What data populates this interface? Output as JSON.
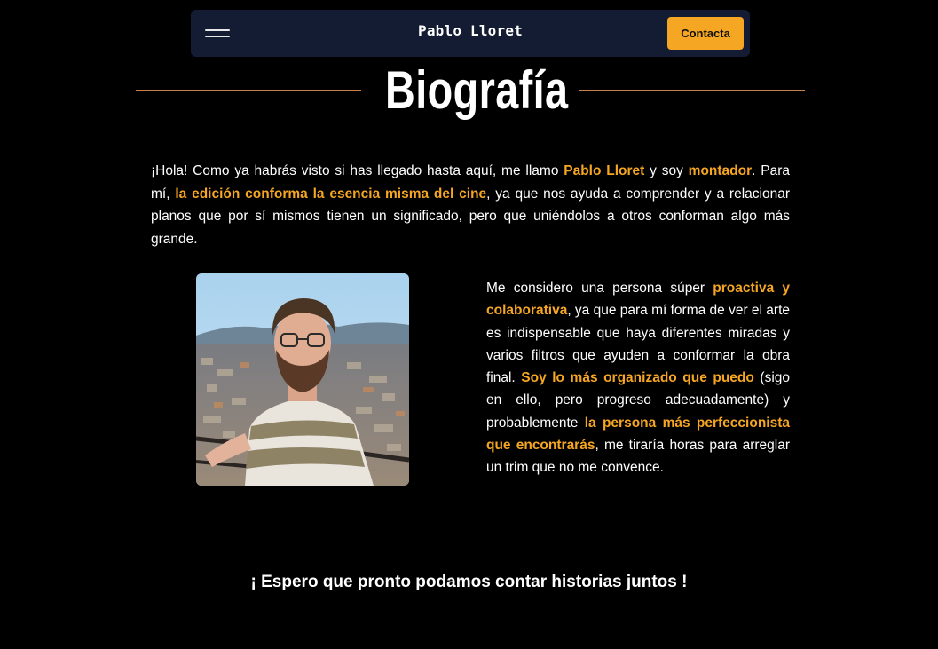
{
  "navbar": {
    "menu_icon": "hamburger-menu-icon",
    "brand": "Pablo Lloret",
    "contact_label": "Contacta"
  },
  "section": {
    "title": "Biografía"
  },
  "intro": {
    "p1": "¡Hola! Como ya habrás visto si has llegado hasta aquí, me llamo ",
    "h1": "Pablo Lloret",
    "p2": " y soy ",
    "h2": "montador",
    "p3": ". Para mí, ",
    "h3": "la edición conforma la esencia misma del cine",
    "p4": ", ya que nos ayuda a comprender y a relacionar planos que por sí mismos tienen un significado, pero que uniéndolos a otros conforman algo más grande."
  },
  "photo": {
    "alt": "Retrato de Pablo Lloret"
  },
  "about": {
    "p1": "Me considero una persona súper ",
    "h1": "proactiva y colaborativa",
    "p2": ", ya que para mí forma de ver el arte es indispensable que haya diferentes miradas y varios filtros que ayuden a conformar la obra final. ",
    "h2": "Soy lo más organizado que puedo",
    "p3": " (sigo en ello, pero progreso adecuadamente) y probablemente ",
    "h3": "la persona más perfeccionista que encontrarás",
    "p4": ", me tiraría horas para arreglar un trim que no me convence."
  },
  "closing": {
    "text": "¡ Espero que pronto podamos contar historias juntos !"
  },
  "colors": {
    "background": "#000000",
    "navbar": "#141c33",
    "accent": "#f5a623",
    "divider": "#c9814a",
    "text": "#ffffff"
  }
}
